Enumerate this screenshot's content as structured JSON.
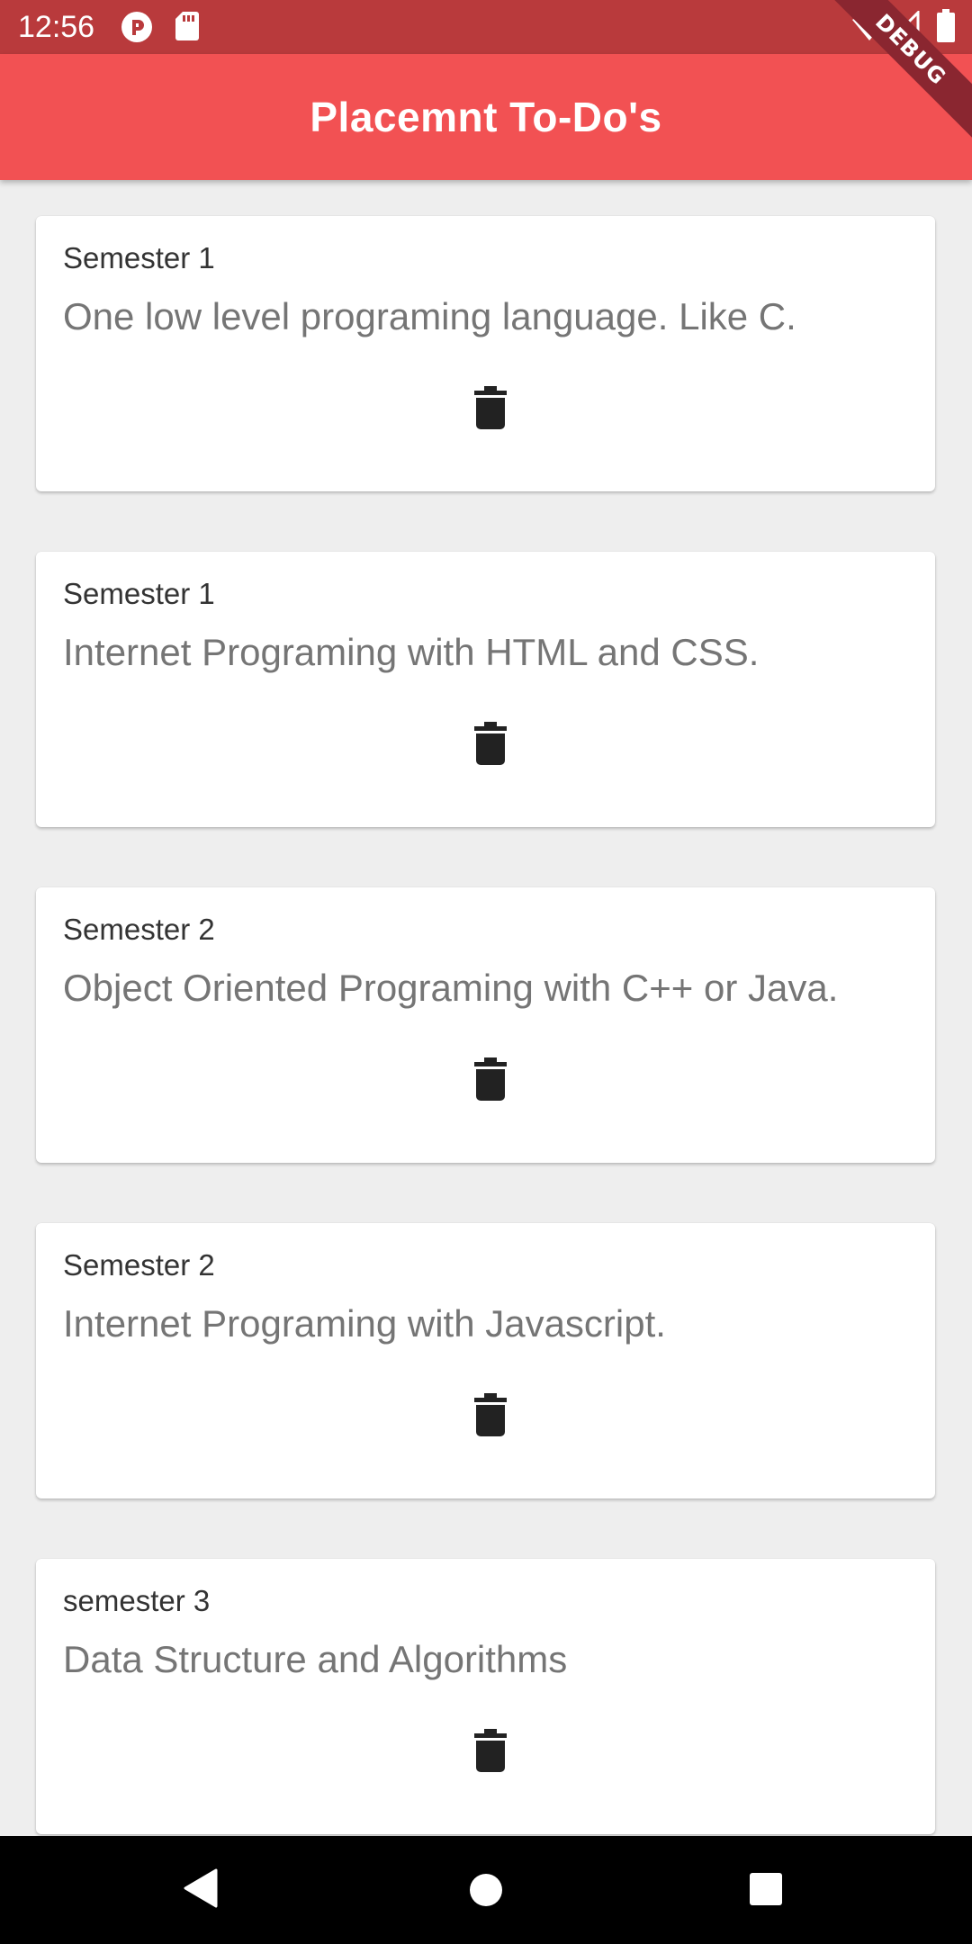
{
  "status_bar": {
    "time": "12:56",
    "icons": [
      "pocket-casts-icon",
      "sd-card-icon",
      "wifi-icon",
      "signal-icon",
      "battery-icon"
    ]
  },
  "app_bar": {
    "title": "Placemnt To-Do's",
    "color": "#f25153"
  },
  "debug_banner": "DEBUG",
  "todos": [
    {
      "semester": "Semester 1",
      "text": "One low level programing language. Like C."
    },
    {
      "semester": "Semester 1",
      "text": "Internet Programing with HTML and CSS."
    },
    {
      "semester": "Semester 2",
      "text": "Object Oriented Programing with C++ or Java."
    },
    {
      "semester": "Semester 2",
      "text": "Internet Programing with Javascript."
    },
    {
      "semester": "semester 3",
      "text": "Data Structure and Algorithms"
    }
  ],
  "delete_icon": "trash-icon",
  "nav_bar": {
    "buttons": [
      "back-icon",
      "home-icon",
      "recents-icon"
    ]
  }
}
